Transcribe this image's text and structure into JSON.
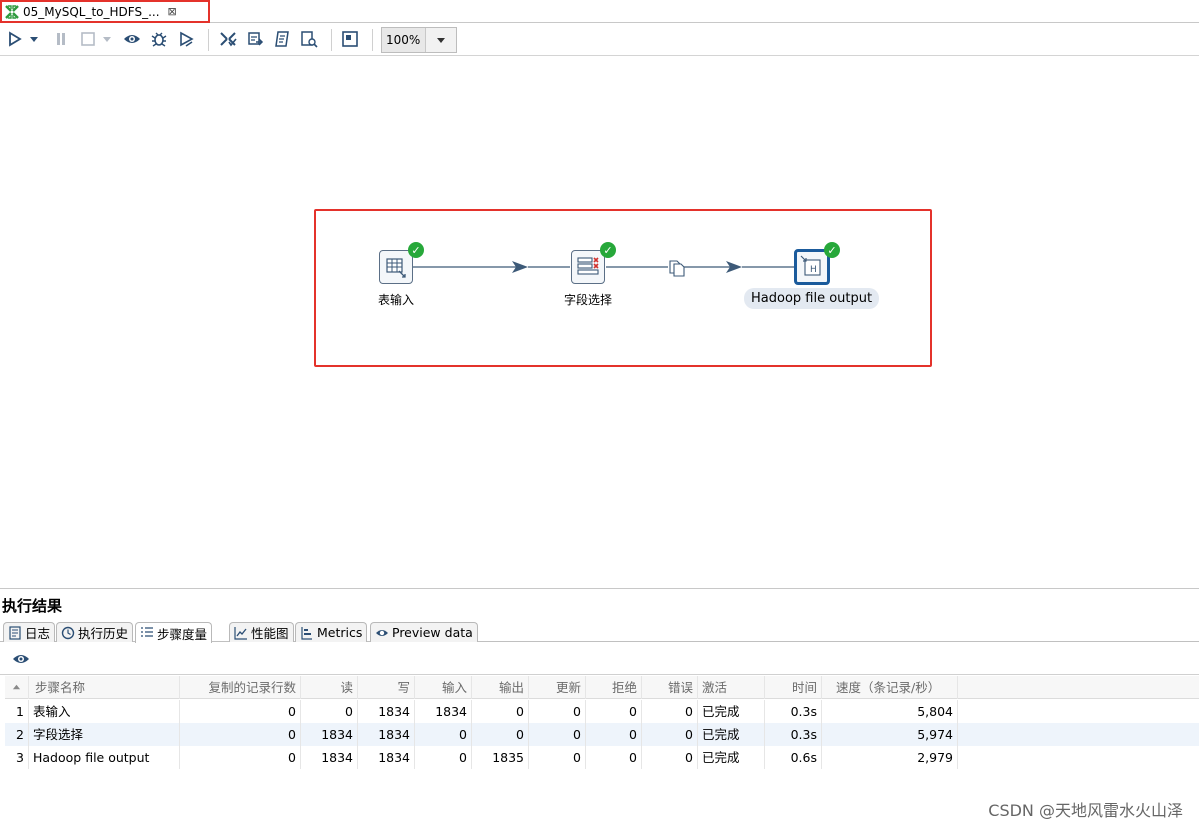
{
  "tab": {
    "title": "05_MySQL_to_HDFS_...",
    "close_glyph": "⊠"
  },
  "toolbar": {
    "zoom_value": "100%",
    "icons": [
      "run-icon",
      "run-dropdown-icon",
      "pause-icon",
      "stop-icon",
      "stop-dropdown-icon",
      "preview-icon",
      "debug-icon",
      "replay-icon",
      "verify-icon",
      "analyze-icon",
      "sql-icon",
      "explore-db-icon",
      "align-icon"
    ]
  },
  "canvas": {
    "steps": [
      {
        "name": "表输入",
        "status": "ok"
      },
      {
        "name": "字段选择",
        "status": "ok"
      },
      {
        "name": "Hadoop file output",
        "status": "ok",
        "selected": true
      }
    ],
    "hops": [
      {
        "from": "表输入",
        "to": "字段选择",
        "copy_icon": false
      },
      {
        "from": "字段选择",
        "to": "Hadoop file output",
        "copy_icon": true
      }
    ],
    "colors": {
      "highlight": "#e4322b",
      "hop": "#3d5a78",
      "ok": "#27a83a",
      "selected_border": "#1b5b9c"
    }
  },
  "results": {
    "title": "执行结果",
    "tabs": [
      {
        "label": "日志",
        "icon": "log-icon"
      },
      {
        "label": "执行历史",
        "icon": "history-icon"
      },
      {
        "label": "步骤度量",
        "icon": "step-metrics-icon",
        "active": true
      },
      {
        "label": "性能图",
        "icon": "performance-chart-icon"
      },
      {
        "label": "Metrics",
        "icon": "metrics-icon"
      },
      {
        "label": "Preview data",
        "icon": "preview-data-icon"
      }
    ],
    "table": {
      "columns": [
        "",
        "步骤名称",
        "复制的记录行数",
        "读",
        "写",
        "输入",
        "输出",
        "更新",
        "拒绝",
        "错误",
        "激活",
        "时间",
        "速度（条记录/秒）"
      ],
      "rows": [
        [
          "1",
          "表输入",
          "0",
          "0",
          "1834",
          "1834",
          "0",
          "0",
          "0",
          "0",
          "已完成",
          "0.3s",
          "5,804"
        ],
        [
          "2",
          "字段选择",
          "0",
          "1834",
          "1834",
          "0",
          "0",
          "0",
          "0",
          "0",
          "已完成",
          "0.3s",
          "5,974"
        ],
        [
          "3",
          "Hadoop file output",
          "0",
          "1834",
          "1834",
          "0",
          "1835",
          "0",
          "0",
          "0",
          "已完成",
          "0.6s",
          "2,979"
        ]
      ]
    }
  },
  "watermark": "CSDN @天地风雷水火山泽"
}
